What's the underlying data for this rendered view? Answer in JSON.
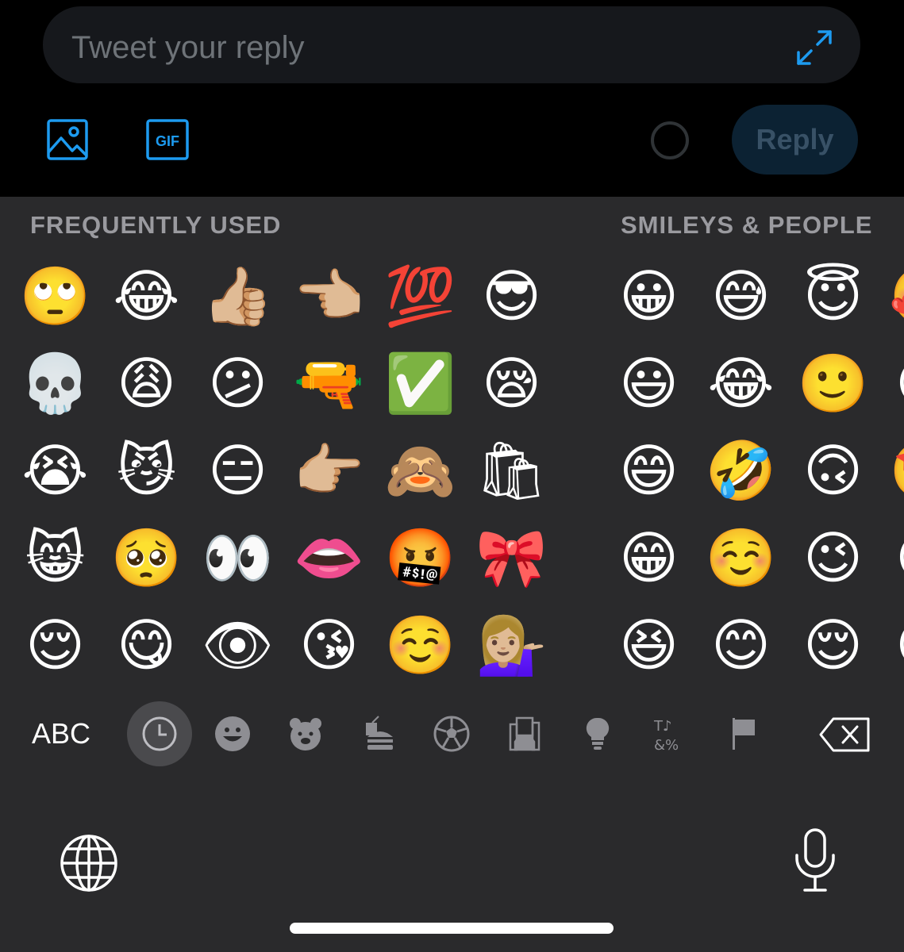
{
  "compose": {
    "placeholder": "Tweet your reply",
    "gif_label": "GIF",
    "reply_label": "Reply",
    "accent_color": "#1d9bf0"
  },
  "keyboard": {
    "sections": {
      "frequent": "FREQUENTLY USED",
      "smileys": "SMILEYS & PEOPLE"
    },
    "frequent_emojis": [
      "🙄",
      "😂",
      "👍🏼",
      "👈🏼",
      "💯",
      "😎",
      "💀",
      "😩",
      "😕",
      "🔫",
      "✅",
      "😪",
      "😭",
      "😼",
      "😑",
      "👉🏼",
      "🙈",
      "🛍",
      "😸",
      "🥺",
      "👀",
      "👄",
      "🤬",
      "🎀",
      "😌",
      "😋",
      "👁",
      "😘",
      "☺️",
      "💁🏼‍♀️"
    ],
    "smiley_emojis": [
      "😀",
      "😅",
      "😇",
      "🥰",
      "😃",
      "😂",
      "🙂",
      "😍",
      "😄",
      "🤣",
      "🙃",
      "🤩",
      "😁",
      "☺️",
      "😉",
      "😘",
      "😆",
      "😊",
      "😌",
      "😗"
    ],
    "abc_label": "ABC",
    "categories": [
      "recent-icon",
      "smileys-icon",
      "animals-icon",
      "food-icon",
      "activity-icon",
      "travel-icon",
      "objects-icon",
      "symbols-icon",
      "flags-icon"
    ],
    "active_category": "recent-icon"
  }
}
